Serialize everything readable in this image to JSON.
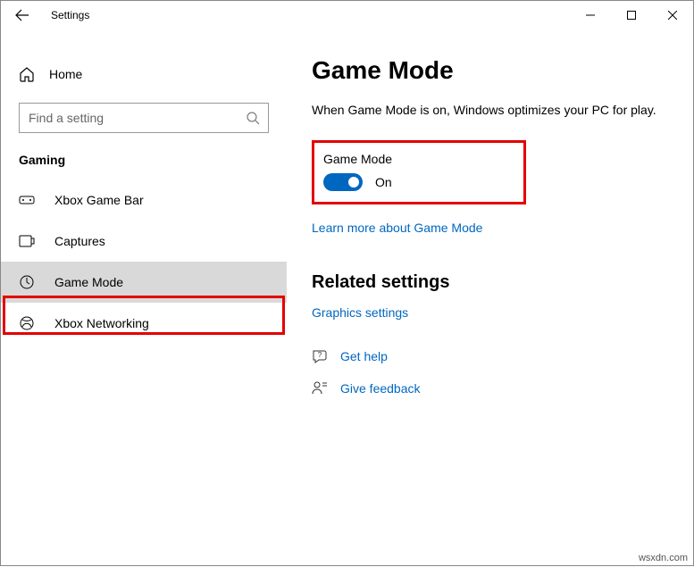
{
  "window": {
    "title": "Settings"
  },
  "sidebar": {
    "home_label": "Home",
    "search_placeholder": "Find a setting",
    "category": "Gaming",
    "items": [
      {
        "label": "Xbox Game Bar"
      },
      {
        "label": "Captures"
      },
      {
        "label": "Game Mode"
      },
      {
        "label": "Xbox Networking"
      }
    ]
  },
  "content": {
    "title": "Game Mode",
    "intro": "When Game Mode is on, Windows optimizes your PC for play.",
    "toggle_label": "Game Mode",
    "toggle_state": "On",
    "learn_more": "Learn more about Game Mode",
    "related_heading": "Related settings",
    "graphics_link": "Graphics settings",
    "get_help": "Get help",
    "give_feedback": "Give feedback"
  },
  "watermark": "wsxdn.com"
}
